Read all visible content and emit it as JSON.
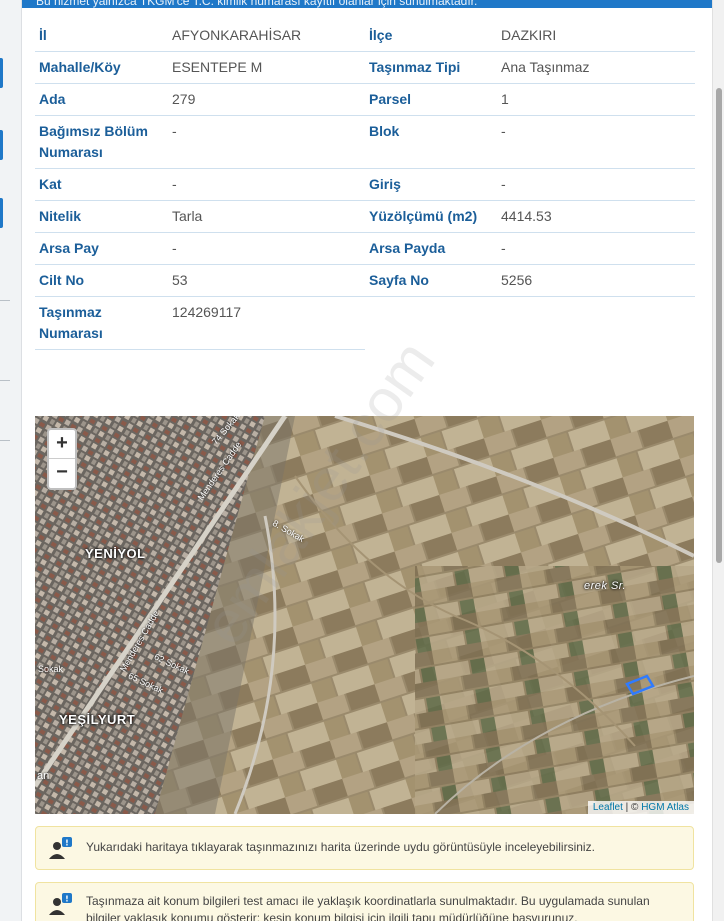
{
  "header_text": "Bu hizmet yalnızca TKGM'ce T.C. kimlik numarası kayıtlı olanlar için sunulmaktadır.",
  "parcel": {
    "rows": [
      [
        {
          "label": "İl",
          "value": "AFYONKARAHİSAR"
        },
        {
          "label": "İlçe",
          "value": "DAZKIRI"
        }
      ],
      [
        {
          "label": "Mahalle/Köy",
          "value": "ESENTEPE M"
        },
        {
          "label": "Taşınmaz Tipi",
          "value": "Ana Taşınmaz"
        }
      ],
      [
        {
          "label": "Ada",
          "value": "279"
        },
        {
          "label": "Parsel",
          "value": "1"
        }
      ],
      [
        {
          "label": "Bağımsız Bölüm Numarası",
          "value": "-"
        },
        {
          "label": "Blok",
          "value": "-"
        }
      ],
      [
        {
          "label": "Kat",
          "value": "-"
        },
        {
          "label": "Giriş",
          "value": "-"
        }
      ],
      [
        {
          "label": "Nitelik",
          "value": "Tarla"
        },
        {
          "label": "Yüzölçümü (m2)",
          "value": "4414.53"
        }
      ],
      [
        {
          "label": "Arsa Pay",
          "value": "-"
        },
        {
          "label": "Arsa Payda",
          "value": "-"
        }
      ],
      [
        {
          "label": "Cilt No",
          "value": "53"
        },
        {
          "label": "Sayfa No",
          "value": "5256"
        }
      ],
      [
        {
          "label": "Taşınmaz Numarası",
          "value": "124269117"
        }
      ]
    ]
  },
  "map": {
    "zoom_in": "+",
    "zoom_out": "−",
    "labels": {
      "yeniyol": "YENİYOL",
      "yesilyurt": "YEŞİLYURT",
      "menderes1": "Menderes Cadde",
      "menderes2": "Menderes Cadde",
      "s74": "74 Sokak",
      "s8": "8. Sokak",
      "s62": "62 Sokak",
      "s65": "65 Sokak",
      "sokak": "Sokak",
      "an": "an",
      "erek": "erek Sr."
    },
    "attribution_leaflet": "Leaflet",
    "attribution_sep": " | © ",
    "attribution_hgm": "HGM Atlas"
  },
  "info1": "Yukarıdaki haritaya tıklayarak taşınmazınızı harita üzerinde uydu görüntüsüyle inceleyebilirsiniz.",
  "info2": "Taşınmaza ait konum bilgileri test amacı ile yaklaşık koordinatlarla sunulmaktadır. Bu uygulamada sunulan bilgiler yaklaşık konumu gösterir; kesin konum bilgisi için ilgili tapu müdürlüğüne başvurunuz.",
  "watermark": "emlakjet.com",
  "colors": {
    "label": "#1b5e99",
    "accent": "#1f78c8",
    "info_bg": "#fcf8e3"
  }
}
